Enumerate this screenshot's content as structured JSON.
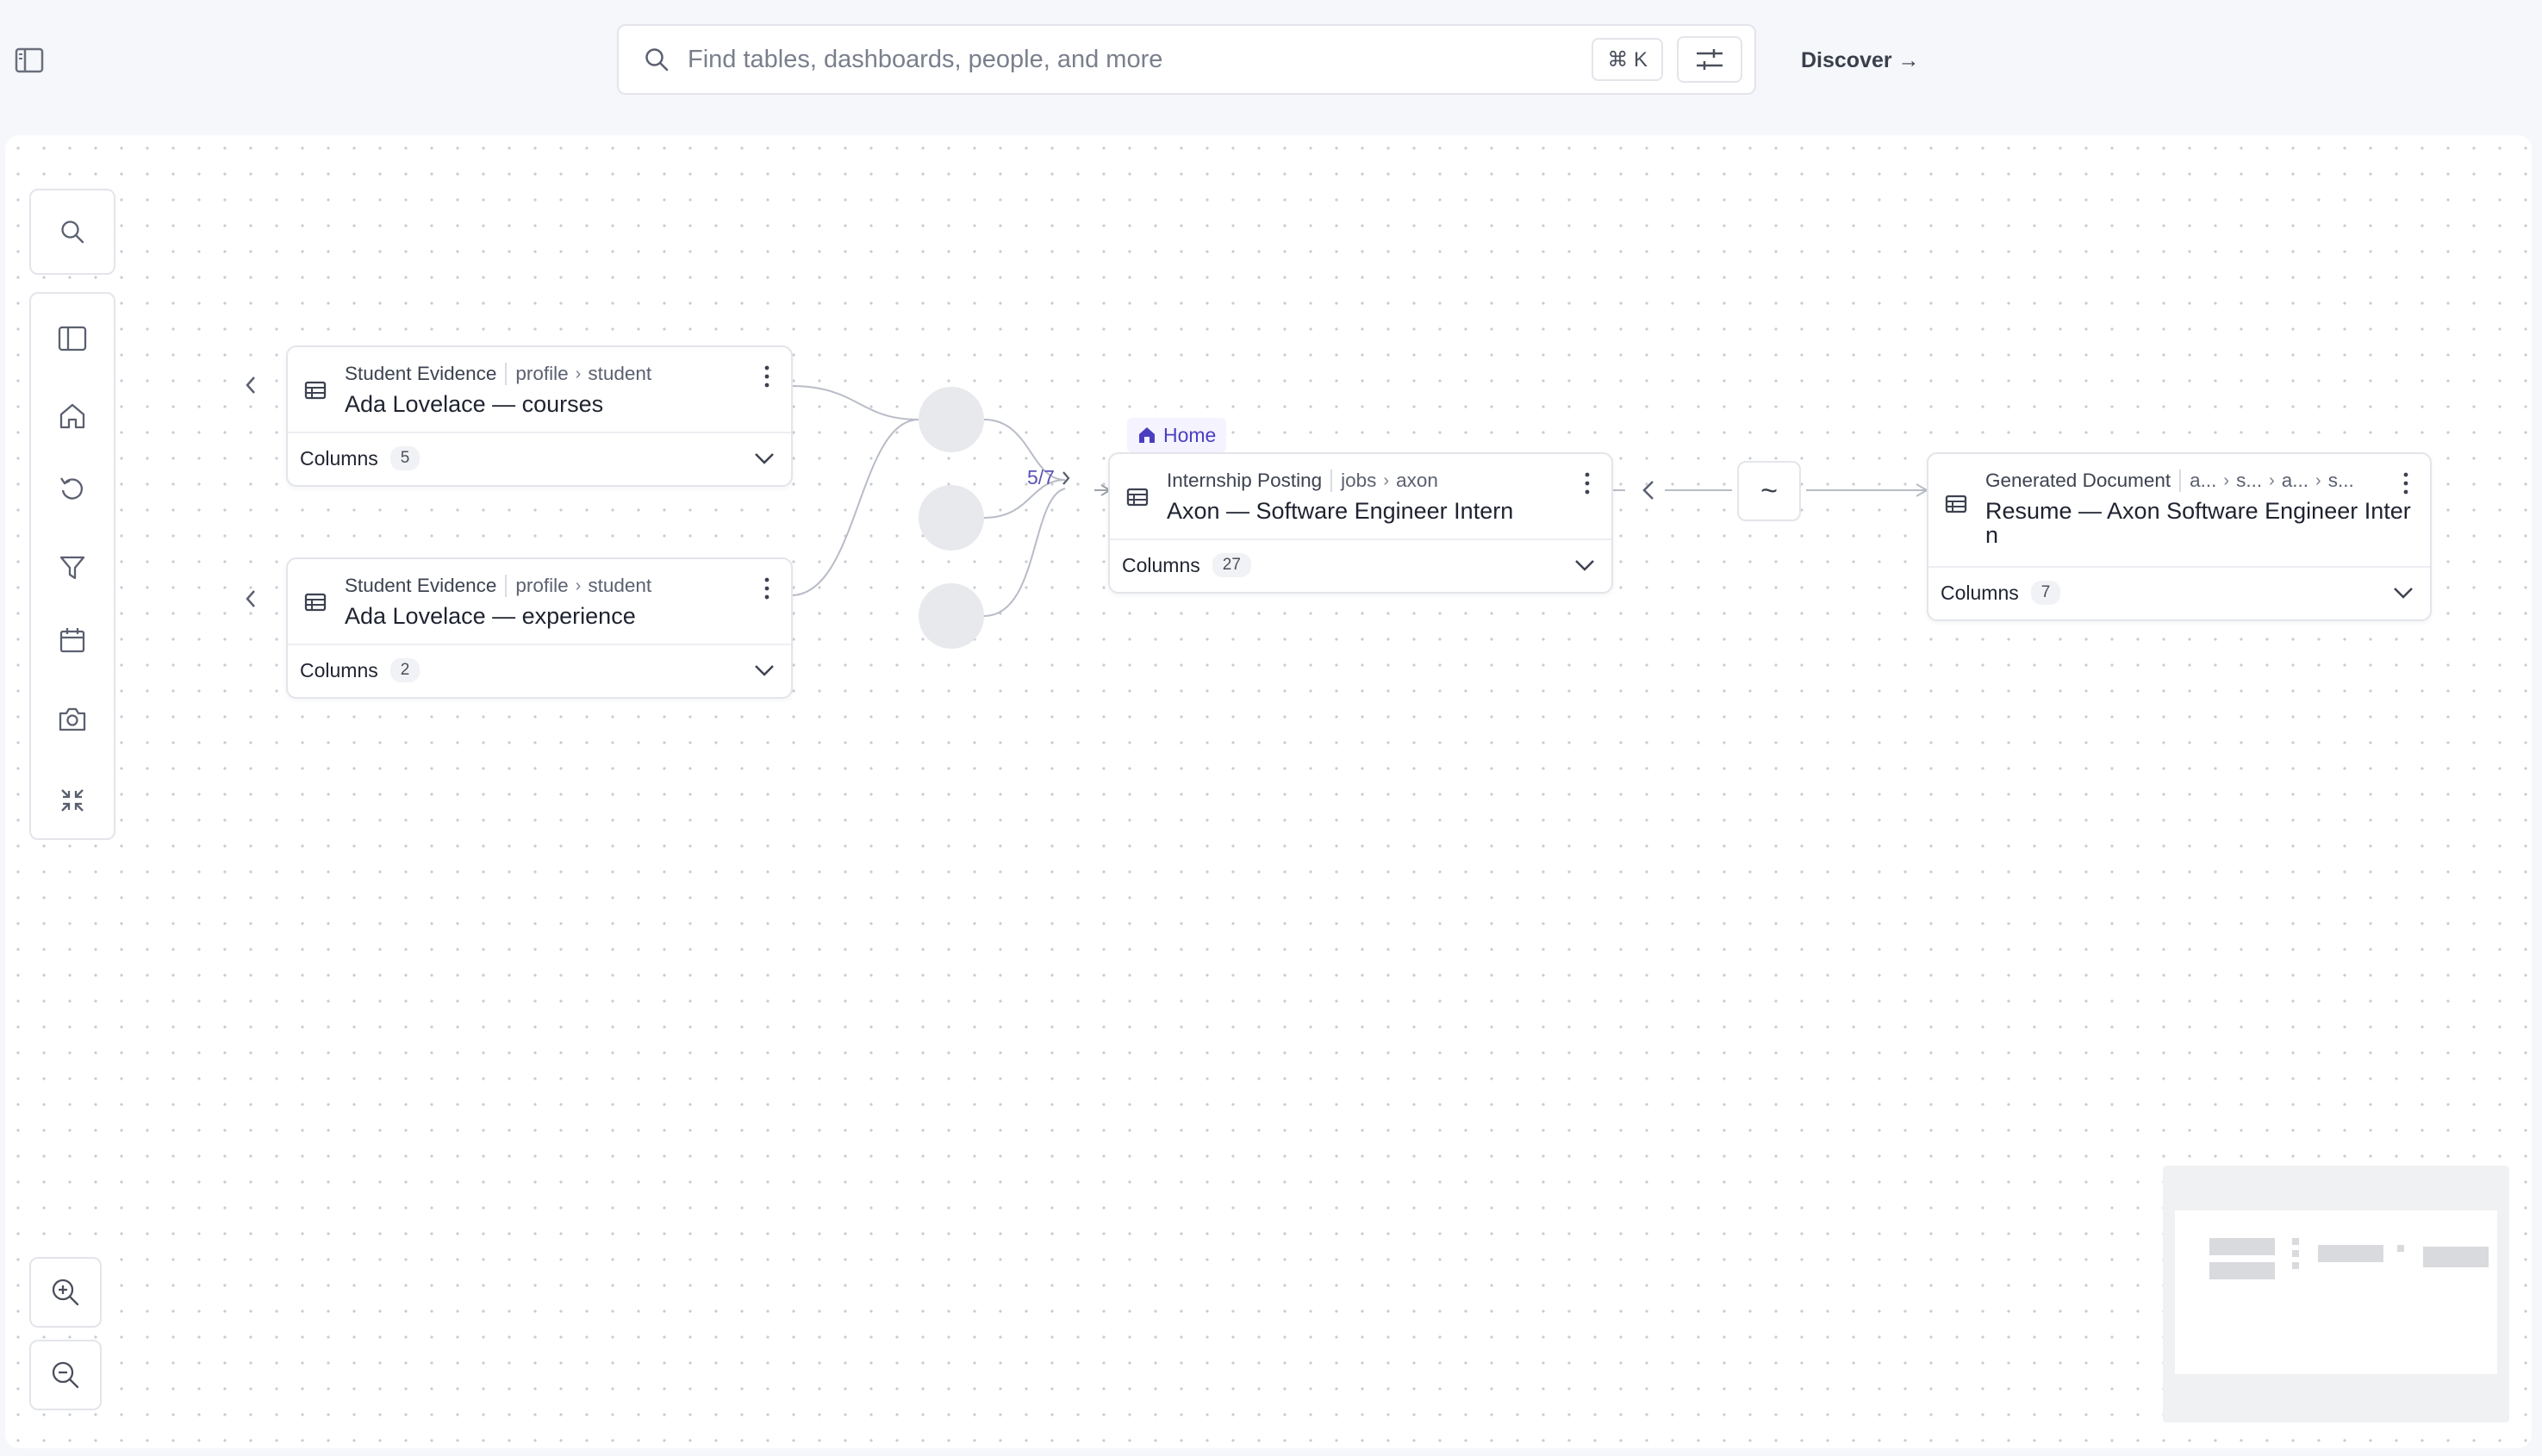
{
  "header": {
    "search_placeholder": "Find tables, dashboards, people, and more",
    "shortcut": "⌘ K",
    "discover_label": "Discover →"
  },
  "nodes": {
    "courses": {
      "kind": "Student Evidence",
      "path": [
        "profile",
        "student"
      ],
      "title": "Ada Lovelace — courses",
      "columns_label": "Columns",
      "columns_count": "5"
    },
    "experience": {
      "kind": "Student Evidence",
      "path": [
        "profile",
        "student"
      ],
      "title": "Ada Lovelace — experience",
      "columns_label": "Columns",
      "columns_count": "2"
    },
    "posting": {
      "badge": "Home",
      "kind": "Internship Posting",
      "path": [
        "jobs",
        "axon"
      ],
      "title": "Axon — Software Engineer Intern",
      "columns_label": "Columns",
      "columns_count": "27"
    },
    "resume": {
      "kind": "Generated Document",
      "path": [
        "a...",
        "s...",
        "a...",
        "s..."
      ],
      "title_line1": "Resume — Axon Software Engineer Inter",
      "title_line2": "n",
      "columns_label": "Columns",
      "columns_count": "7"
    }
  },
  "pager": "5/7",
  "transform_symbol": "~",
  "colors": {
    "accent": "#4b3fc0",
    "edge": "#b8bcc6",
    "bubble": "#e8e9ec"
  }
}
